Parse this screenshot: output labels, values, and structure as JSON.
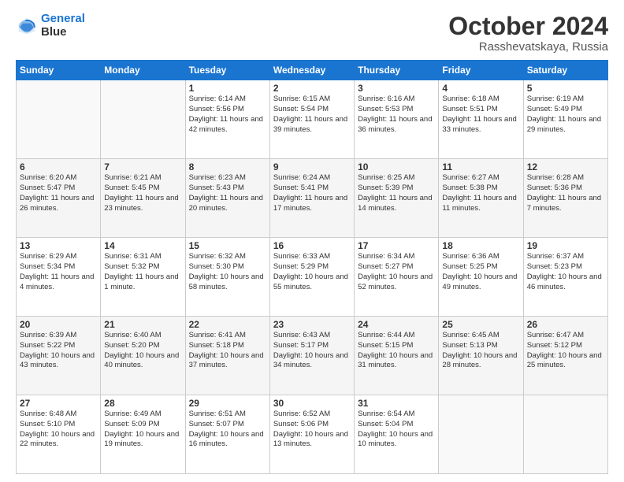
{
  "logo": {
    "line1": "General",
    "line2": "Blue"
  },
  "title": "October 2024",
  "location": "Rasshevatskaya, Russia",
  "days_header": [
    "Sunday",
    "Monday",
    "Tuesday",
    "Wednesday",
    "Thursday",
    "Friday",
    "Saturday"
  ],
  "weeks": [
    [
      {
        "num": "",
        "sunrise": "",
        "sunset": "",
        "daylight": ""
      },
      {
        "num": "",
        "sunrise": "",
        "sunset": "",
        "daylight": ""
      },
      {
        "num": "1",
        "sunrise": "Sunrise: 6:14 AM",
        "sunset": "Sunset: 5:56 PM",
        "daylight": "Daylight: 11 hours and 42 minutes."
      },
      {
        "num": "2",
        "sunrise": "Sunrise: 6:15 AM",
        "sunset": "Sunset: 5:54 PM",
        "daylight": "Daylight: 11 hours and 39 minutes."
      },
      {
        "num": "3",
        "sunrise": "Sunrise: 6:16 AM",
        "sunset": "Sunset: 5:53 PM",
        "daylight": "Daylight: 11 hours and 36 minutes."
      },
      {
        "num": "4",
        "sunrise": "Sunrise: 6:18 AM",
        "sunset": "Sunset: 5:51 PM",
        "daylight": "Daylight: 11 hours and 33 minutes."
      },
      {
        "num": "5",
        "sunrise": "Sunrise: 6:19 AM",
        "sunset": "Sunset: 5:49 PM",
        "daylight": "Daylight: 11 hours and 29 minutes."
      }
    ],
    [
      {
        "num": "6",
        "sunrise": "Sunrise: 6:20 AM",
        "sunset": "Sunset: 5:47 PM",
        "daylight": "Daylight: 11 hours and 26 minutes."
      },
      {
        "num": "7",
        "sunrise": "Sunrise: 6:21 AM",
        "sunset": "Sunset: 5:45 PM",
        "daylight": "Daylight: 11 hours and 23 minutes."
      },
      {
        "num": "8",
        "sunrise": "Sunrise: 6:23 AM",
        "sunset": "Sunset: 5:43 PM",
        "daylight": "Daylight: 11 hours and 20 minutes."
      },
      {
        "num": "9",
        "sunrise": "Sunrise: 6:24 AM",
        "sunset": "Sunset: 5:41 PM",
        "daylight": "Daylight: 11 hours and 17 minutes."
      },
      {
        "num": "10",
        "sunrise": "Sunrise: 6:25 AM",
        "sunset": "Sunset: 5:39 PM",
        "daylight": "Daylight: 11 hours and 14 minutes."
      },
      {
        "num": "11",
        "sunrise": "Sunrise: 6:27 AM",
        "sunset": "Sunset: 5:38 PM",
        "daylight": "Daylight: 11 hours and 11 minutes."
      },
      {
        "num": "12",
        "sunrise": "Sunrise: 6:28 AM",
        "sunset": "Sunset: 5:36 PM",
        "daylight": "Daylight: 11 hours and 7 minutes."
      }
    ],
    [
      {
        "num": "13",
        "sunrise": "Sunrise: 6:29 AM",
        "sunset": "Sunset: 5:34 PM",
        "daylight": "Daylight: 11 hours and 4 minutes."
      },
      {
        "num": "14",
        "sunrise": "Sunrise: 6:31 AM",
        "sunset": "Sunset: 5:32 PM",
        "daylight": "Daylight: 11 hours and 1 minute."
      },
      {
        "num": "15",
        "sunrise": "Sunrise: 6:32 AM",
        "sunset": "Sunset: 5:30 PM",
        "daylight": "Daylight: 10 hours and 58 minutes."
      },
      {
        "num": "16",
        "sunrise": "Sunrise: 6:33 AM",
        "sunset": "Sunset: 5:29 PM",
        "daylight": "Daylight: 10 hours and 55 minutes."
      },
      {
        "num": "17",
        "sunrise": "Sunrise: 6:34 AM",
        "sunset": "Sunset: 5:27 PM",
        "daylight": "Daylight: 10 hours and 52 minutes."
      },
      {
        "num": "18",
        "sunrise": "Sunrise: 6:36 AM",
        "sunset": "Sunset: 5:25 PM",
        "daylight": "Daylight: 10 hours and 49 minutes."
      },
      {
        "num": "19",
        "sunrise": "Sunrise: 6:37 AM",
        "sunset": "Sunset: 5:23 PM",
        "daylight": "Daylight: 10 hours and 46 minutes."
      }
    ],
    [
      {
        "num": "20",
        "sunrise": "Sunrise: 6:39 AM",
        "sunset": "Sunset: 5:22 PM",
        "daylight": "Daylight: 10 hours and 43 minutes."
      },
      {
        "num": "21",
        "sunrise": "Sunrise: 6:40 AM",
        "sunset": "Sunset: 5:20 PM",
        "daylight": "Daylight: 10 hours and 40 minutes."
      },
      {
        "num": "22",
        "sunrise": "Sunrise: 6:41 AM",
        "sunset": "Sunset: 5:18 PM",
        "daylight": "Daylight: 10 hours and 37 minutes."
      },
      {
        "num": "23",
        "sunrise": "Sunrise: 6:43 AM",
        "sunset": "Sunset: 5:17 PM",
        "daylight": "Daylight: 10 hours and 34 minutes."
      },
      {
        "num": "24",
        "sunrise": "Sunrise: 6:44 AM",
        "sunset": "Sunset: 5:15 PM",
        "daylight": "Daylight: 10 hours and 31 minutes."
      },
      {
        "num": "25",
        "sunrise": "Sunrise: 6:45 AM",
        "sunset": "Sunset: 5:13 PM",
        "daylight": "Daylight: 10 hours and 28 minutes."
      },
      {
        "num": "26",
        "sunrise": "Sunrise: 6:47 AM",
        "sunset": "Sunset: 5:12 PM",
        "daylight": "Daylight: 10 hours and 25 minutes."
      }
    ],
    [
      {
        "num": "27",
        "sunrise": "Sunrise: 6:48 AM",
        "sunset": "Sunset: 5:10 PM",
        "daylight": "Daylight: 10 hours and 22 minutes."
      },
      {
        "num": "28",
        "sunrise": "Sunrise: 6:49 AM",
        "sunset": "Sunset: 5:09 PM",
        "daylight": "Daylight: 10 hours and 19 minutes."
      },
      {
        "num": "29",
        "sunrise": "Sunrise: 6:51 AM",
        "sunset": "Sunset: 5:07 PM",
        "daylight": "Daylight: 10 hours and 16 minutes."
      },
      {
        "num": "30",
        "sunrise": "Sunrise: 6:52 AM",
        "sunset": "Sunset: 5:06 PM",
        "daylight": "Daylight: 10 hours and 13 minutes."
      },
      {
        "num": "31",
        "sunrise": "Sunrise: 6:54 AM",
        "sunset": "Sunset: 5:04 PM",
        "daylight": "Daylight: 10 hours and 10 minutes."
      },
      {
        "num": "",
        "sunrise": "",
        "sunset": "",
        "daylight": ""
      },
      {
        "num": "",
        "sunrise": "",
        "sunset": "",
        "daylight": ""
      }
    ]
  ]
}
